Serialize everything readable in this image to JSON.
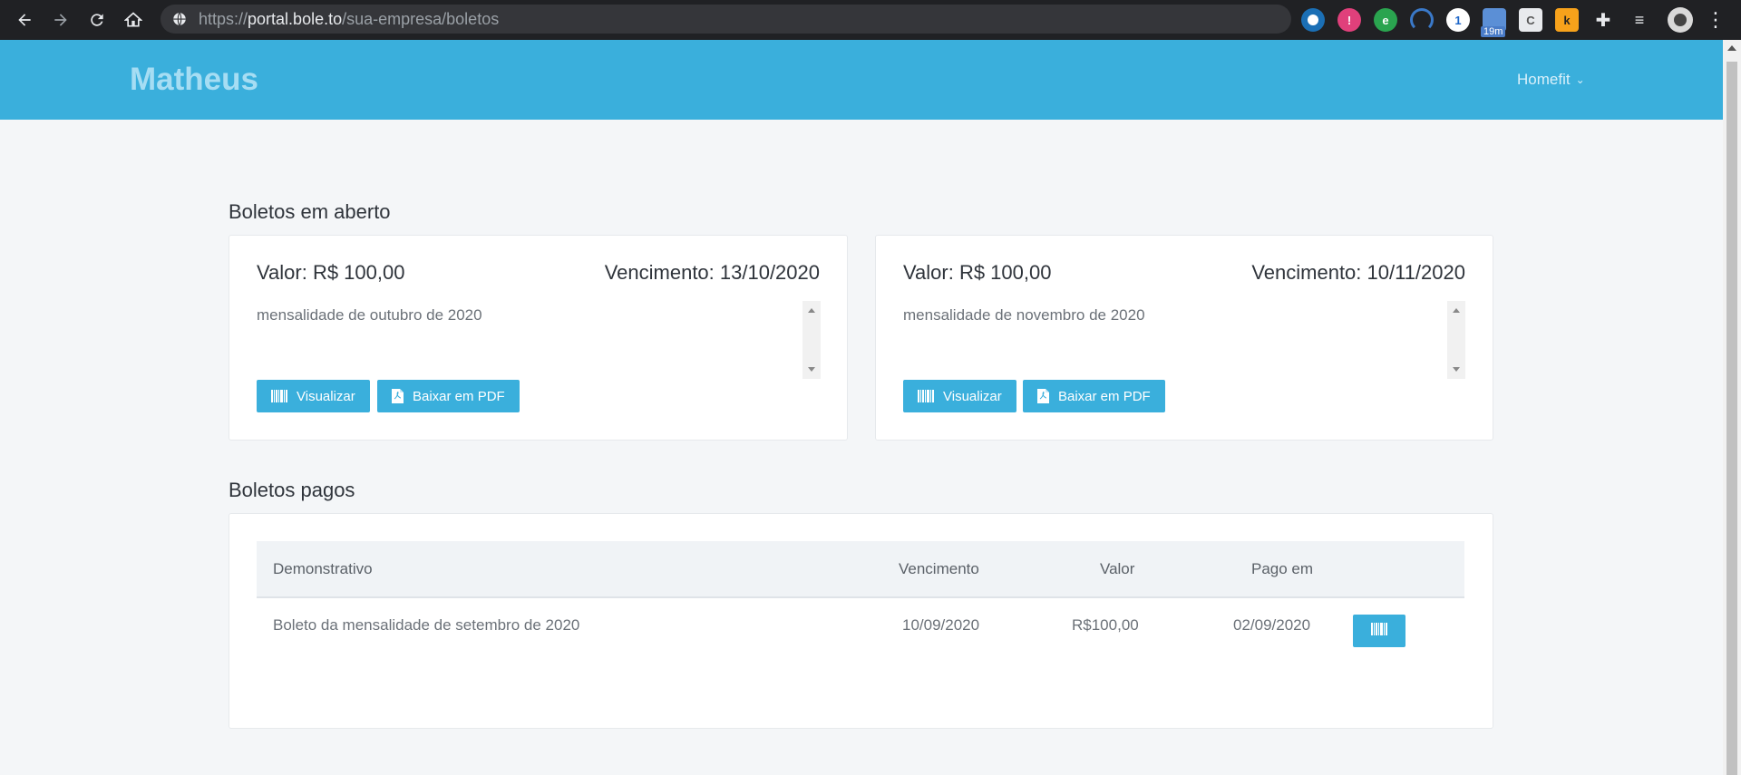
{
  "browser": {
    "url_prefix": "https://",
    "url_host": "portal.bole.to",
    "url_path": "/sua-empresa/boletos",
    "extension_badge": "19m"
  },
  "header": {
    "brand": "Matheus",
    "company_menu": "Homefit"
  },
  "open_section": {
    "title": "Boletos em aberto",
    "bills": [
      {
        "valor": "Valor: R$ 100,00",
        "vencimento": "Vencimento: 13/10/2020",
        "descricao": "mensalidade de outubro de 2020",
        "visualizar_label": "Visualizar",
        "pdf_label": "Baixar em PDF"
      },
      {
        "valor": "Valor: R$ 100,00",
        "vencimento": "Vencimento: 10/11/2020",
        "descricao": "mensalidade de novembro de 2020",
        "visualizar_label": "Visualizar",
        "pdf_label": "Baixar em PDF"
      }
    ]
  },
  "paid_section": {
    "title": "Boletos pagos",
    "columns": [
      "Demonstrativo",
      "Vencimento",
      "Valor",
      "Pago em"
    ],
    "rows": [
      {
        "demonstrativo": "Boleto da mensalidade de setembro de 2020",
        "vencimento": "10/09/2020",
        "valor": "R$100,00",
        "pago_em": "02/09/2020"
      }
    ]
  },
  "colors": {
    "accent": "#3aafdc",
    "page_bg": "#f4f6f8",
    "chrome_bg": "#202124"
  }
}
